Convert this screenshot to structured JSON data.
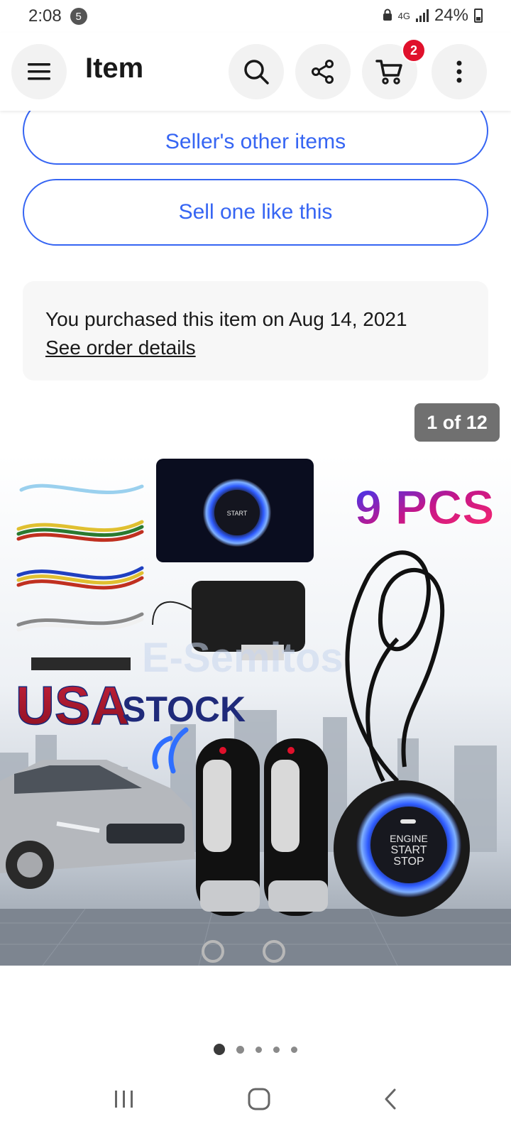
{
  "status_bar": {
    "time": "2:08",
    "notification_count": "5",
    "network": "4G",
    "battery": "24%"
  },
  "header": {
    "title": "Item",
    "cart_count": "2",
    "icons": [
      "menu-icon",
      "search-icon",
      "share-icon",
      "cart-icon",
      "more-vertical-icon"
    ]
  },
  "actions": {
    "sellers_other_items": "Seller's other items",
    "sell_one_like_this": "Sell one like this"
  },
  "purchase": {
    "text": "You purchased this item on Aug 14, 2021",
    "link": "See order details"
  },
  "gallery": {
    "counter": "1 of 12",
    "image_text": {
      "pcs": "9 PCS",
      "usa": "USA",
      "stock": "STOCK",
      "watermark": "E-Semitos",
      "button_engine": "ENGINE",
      "button_start": "START",
      "button_stop": "STOP"
    },
    "dot_count": 5,
    "active_dot": 0
  },
  "colors": {
    "accent": "#3665f3",
    "badge": "#e0102b",
    "card_bg": "#f7f7f7"
  },
  "nav_bar": {
    "icons": [
      "recents-icon",
      "home-icon",
      "back-icon"
    ]
  }
}
